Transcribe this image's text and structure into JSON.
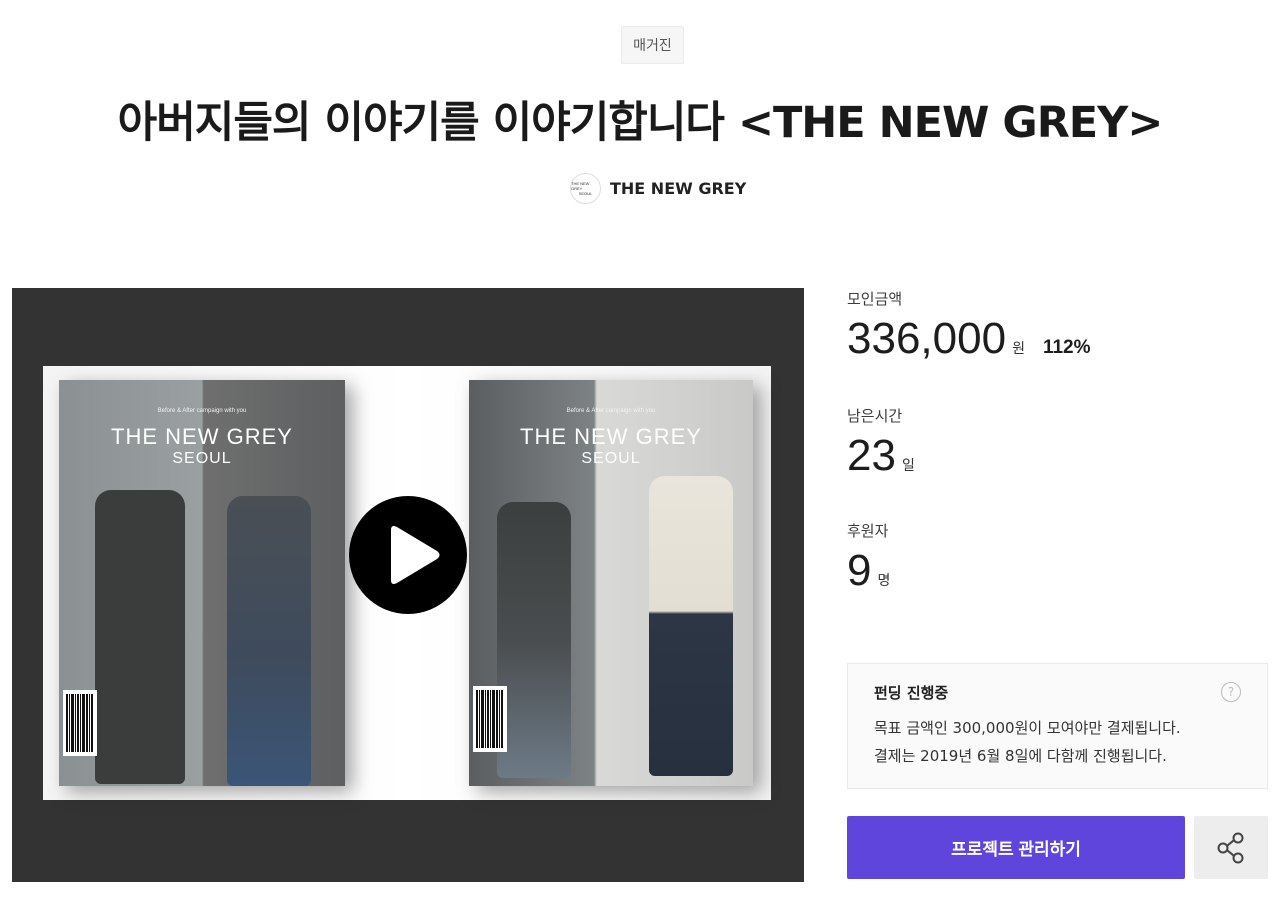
{
  "category": "매거진",
  "title": "아버지들의 이야기를 이야기합니다 <THE NEW GREY>",
  "creator": {
    "name": "THE NEW GREY",
    "avatar_text_top": "THE NEW GREY",
    "avatar_text_bottom": "SEOUL"
  },
  "video": {
    "cover_tagline": "Before & After campaign with you",
    "cover_title": "THE NEW GREY",
    "cover_sub": "SEOUL",
    "play_icon": "play-icon"
  },
  "stats": {
    "raised_label": "모인금액",
    "raised_value": "336,000",
    "raised_unit": "원",
    "raised_percent": "112%",
    "remaining_label": "남은시간",
    "remaining_value": "23",
    "remaining_unit": "일",
    "backers_label": "후원자",
    "backers_value": "9",
    "backers_unit": "명"
  },
  "notice": {
    "title": "펀딩 진행중",
    "line1": "목표 금액인 300,000원이 모여야만 결제됩니다.",
    "line2": "결제는 2019년 6월 8일에 다함께 진행됩니다.",
    "help_icon": "?"
  },
  "actions": {
    "manage_label": "프로젝트 관리하기",
    "share_icon": "share-icon"
  },
  "colors": {
    "primary": "#6045dd",
    "video_bg": "#333333"
  }
}
